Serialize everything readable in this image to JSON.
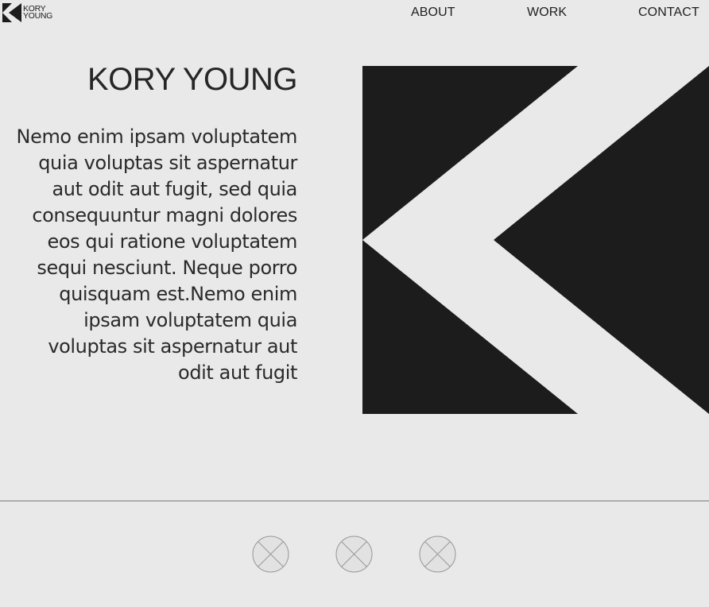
{
  "header": {
    "logo": {
      "line1": "KORY",
      "line2": "YOUNG"
    },
    "nav": [
      {
        "label": "ABOUT"
      },
      {
        "label": "WORK"
      },
      {
        "label": "CONTACT"
      }
    ]
  },
  "hero": {
    "title": "KORY YOUNG",
    "body": "Nemo enim ipsam voluptatem quia voluptas sit aspernatur aut odit aut fugit, sed quia consequuntur magni dolores eos qui ratione voluptatem sequi nesciunt. Neque porro quisquam est.Nemo enim ipsam voluptatem quia voluptas sit aspernatur aut odit aut fugit",
    "graphic_icon": "k-logo-mark-icon"
  },
  "footer": {
    "placeholders": [
      {
        "icon": "image-placeholder-icon"
      },
      {
        "icon": "image-placeholder-icon"
      },
      {
        "icon": "image-placeholder-icon"
      }
    ]
  },
  "colors": {
    "background": "#e9e9e9",
    "text": "#262626",
    "graphic": "#1c1c1c",
    "divider": "#7c7c7c",
    "placeholder_stroke": "#9a9a9a"
  }
}
